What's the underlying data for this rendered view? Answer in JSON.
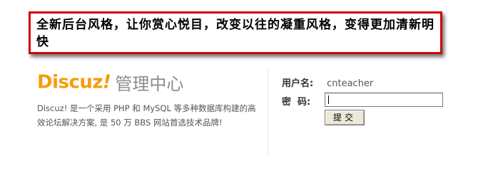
{
  "callout": {
    "text": "全新后台风格，让你赏心悦目，改变以往的凝重风格，变得更加清新明快"
  },
  "brand": {
    "logo_text": "Discuz",
    "logo_bang": "!",
    "console_title": "管理中心",
    "description": "Discuz! 是一个采用 PHP 和 MySQL 等多种数据库构建的高效论坛解决方案, 是 50 万 BBS 网站首选技术品牌!"
  },
  "login": {
    "username_label": "用户名:",
    "username_value": "cnteacher",
    "password_label": "密  码:",
    "password_value": "",
    "submit_label": "提交"
  },
  "colors": {
    "callout_border": "#d40000",
    "logo": "#f49d0b",
    "console_title": "#8c8c8c"
  }
}
